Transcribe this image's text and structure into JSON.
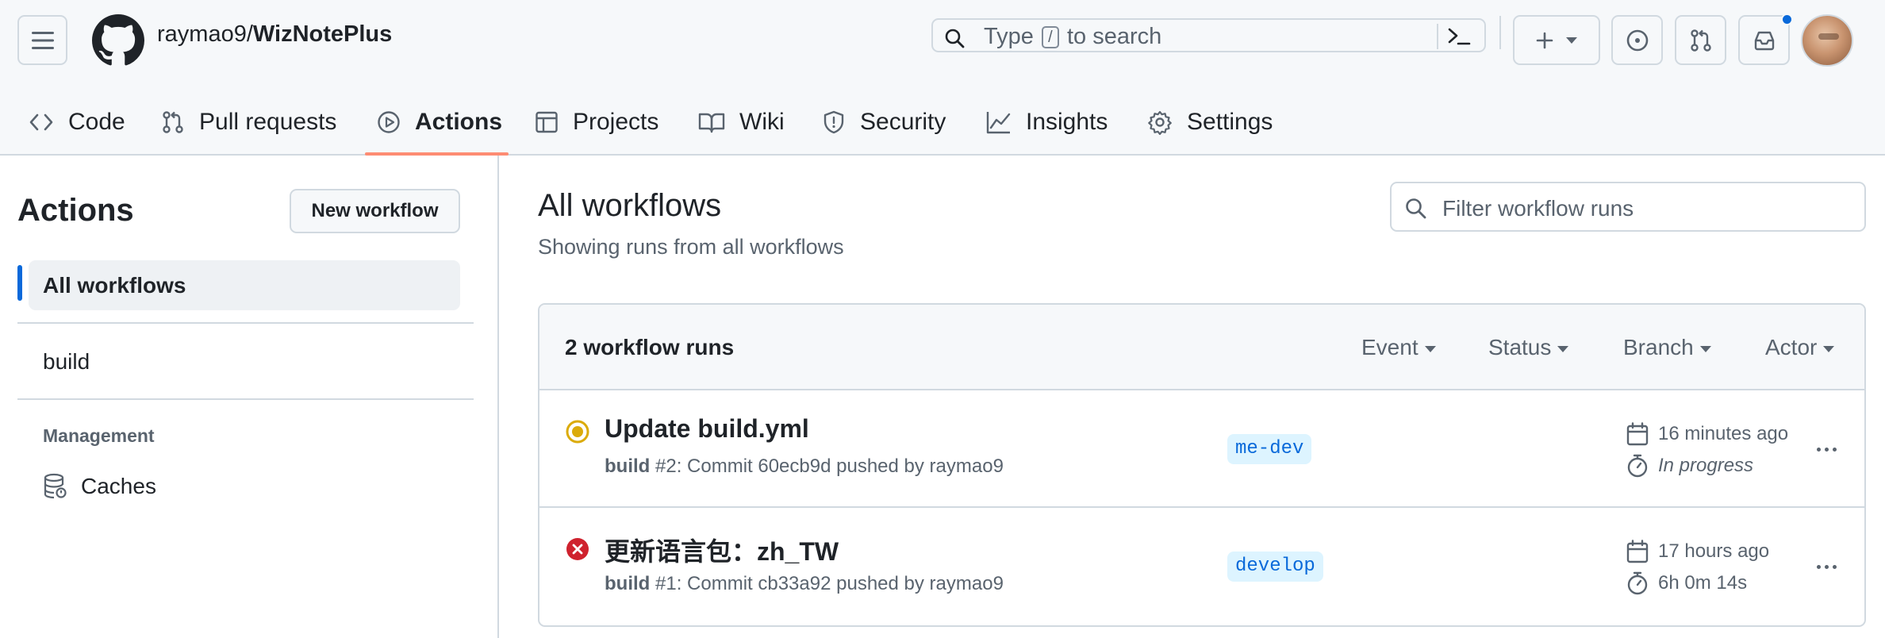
{
  "header": {
    "repo_owner": "raymao9",
    "repo_separator": "/",
    "repo_name": "WizNotePlus",
    "search": {
      "prefix": "Type",
      "key": "/",
      "suffix": "to search"
    },
    "notification_dot_color": "#0969da"
  },
  "repo_nav": {
    "items": [
      {
        "label": "Code",
        "icon": "code-icon"
      },
      {
        "label": "Pull requests",
        "icon": "git-pull-request-icon"
      },
      {
        "label": "Actions",
        "icon": "play-icon",
        "active": true
      },
      {
        "label": "Projects",
        "icon": "table-icon"
      },
      {
        "label": "Wiki",
        "icon": "book-icon"
      },
      {
        "label": "Security",
        "icon": "shield-icon"
      },
      {
        "label": "Insights",
        "icon": "graph-icon"
      },
      {
        "label": "Settings",
        "icon": "gear-icon"
      }
    ],
    "active_underline_color": "#fd8c73"
  },
  "sidebar": {
    "title": "Actions",
    "new_workflow_label": "New workflow",
    "items": [
      {
        "label": "All workflows",
        "selected": true
      },
      {
        "label": "build"
      }
    ],
    "management_heading": "Management",
    "caches_label": "Caches"
  },
  "main": {
    "title": "All workflows",
    "subtitle": "Showing runs from all workflows",
    "filter_placeholder": "Filter workflow runs",
    "runs_count": "2 workflow runs",
    "filters": [
      "Event",
      "Status",
      "Branch",
      "Actor"
    ],
    "runs": [
      {
        "status": "in-progress",
        "status_color": "#dbab0a",
        "title": "Update build.yml",
        "workflow": "build",
        "meta": "#2: Commit 60ecb9d pushed by raymao9",
        "branch": "me-dev",
        "when": "16 minutes ago",
        "duration": "In progress"
      },
      {
        "status": "failure",
        "status_color": "#cf222e",
        "title": "更新语言包：zh_TW",
        "workflow": "build",
        "meta": "#1: Commit cb33a92 pushed by raymao9",
        "branch": "develop",
        "when": "17 hours ago",
        "duration": "6h 0m 14s"
      }
    ]
  }
}
